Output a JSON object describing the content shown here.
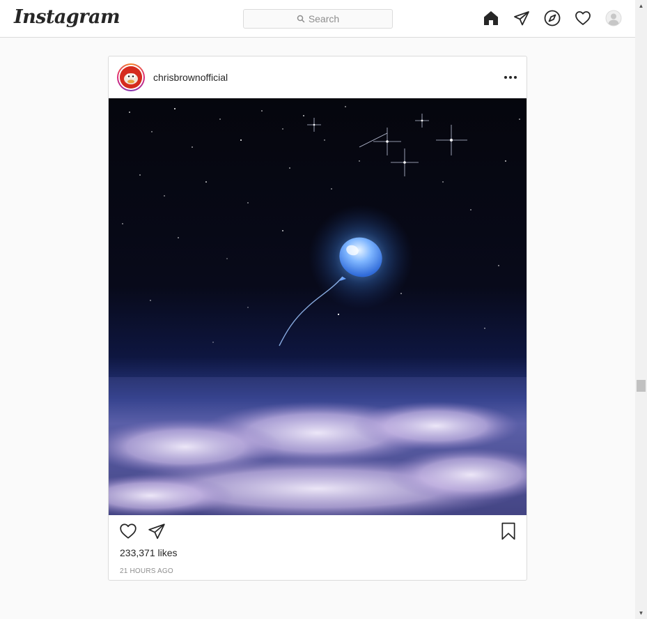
{
  "app": {
    "logo_text": "Instagram",
    "search": {
      "placeholder": "Search"
    },
    "nav_icons": [
      "home-icon",
      "direct-icon",
      "explore-icon",
      "activity-icon",
      "profile-icon"
    ]
  },
  "post": {
    "username": "chrisbrownofficial",
    "likes": "233,371 likes",
    "time_ago": "21 HOURS AGO",
    "image_description_icon": "balloon-in-night-sky-image"
  },
  "colors": {
    "text": "#262626",
    "muted": "#8e8e8e",
    "border": "#dbdbdb",
    "background": "#fafafa"
  }
}
